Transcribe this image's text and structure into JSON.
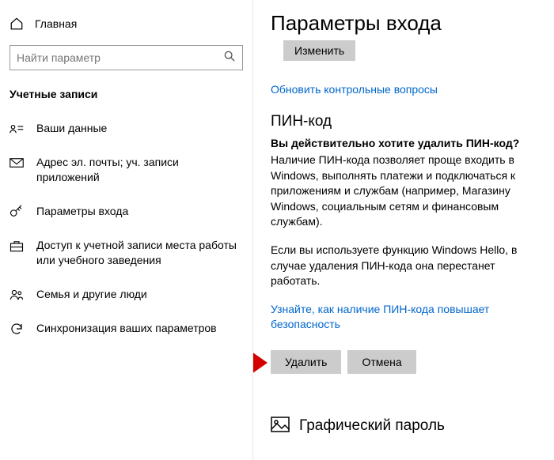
{
  "sidebar": {
    "home": "Главная",
    "search_placeholder": "Найти параметр",
    "section_title": "Учетные записи",
    "items": [
      {
        "label": "Ваши данные"
      },
      {
        "label": "Адрес эл. почты; уч. записи приложений"
      },
      {
        "label": "Параметры входа"
      },
      {
        "label": "Доступ к учетной записи места работы или учебного заведения"
      },
      {
        "label": "Семья и другие люди"
      },
      {
        "label": "Синхронизация ваших параметров"
      }
    ]
  },
  "main": {
    "title": "Параметры входа",
    "change_btn": "Изменить",
    "security_questions_link": "Обновить контрольные вопросы",
    "pin": {
      "heading": "ПИН-код",
      "question": "Вы действительно хотите удалить ПИН-код?",
      "description": "Наличие ПИН-кода позволяет проще входить в Windows, выполнять платежи и подключаться к приложениям и службам (например, Магазину Windows, социальным сетям и финансовым службам).",
      "warning": "Если вы используете функцию Windows Hello, в случае удаления ПИН-кода она перестанет работать.",
      "learn_link": "Узнайте, как наличие ПИН-кода повышает безопасность",
      "delete_btn": "Удалить",
      "cancel_btn": "Отмена"
    },
    "picture_password": "Графический пароль"
  }
}
